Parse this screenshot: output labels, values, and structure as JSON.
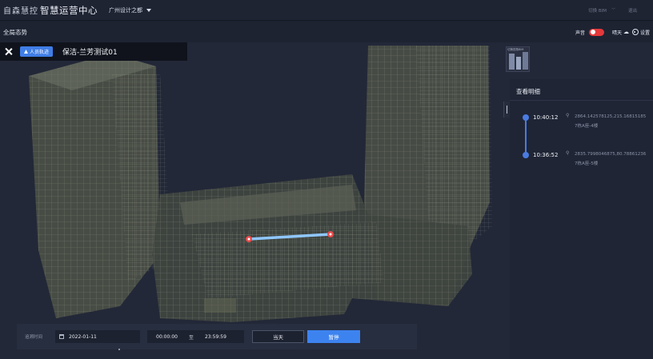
{
  "header": {
    "brand_logo": "自森慧控",
    "brand_title": "智慧运营中心",
    "project": "广州设计之都",
    "user": "切换 BIM",
    "logout": "退出"
  },
  "subheader": {
    "title": "全局态势",
    "sound_label": "声音",
    "weather_label": "晴天",
    "settings_label": "设置"
  },
  "track": {
    "tag": "人员轨迹",
    "name": "保洁-兰芳测试01"
  },
  "thumbnail": {
    "label": "切换视角BIM"
  },
  "panel": {
    "title": "查看明细",
    "records": [
      {
        "time": "10:40:12",
        "coord": "2864.142578125,215.16815185",
        "floor": "7栋A座-4楼"
      },
      {
        "time": "10:36:52",
        "coord": "2835.7998046875,80.78861236",
        "floor": "7栋A座-5楼"
      }
    ]
  },
  "query": {
    "label": "追溯时间",
    "date": "2022-01-11",
    "start_time": "00:00:00",
    "separator": "至",
    "end_time": "23:59:59",
    "today_btn": "当天",
    "pause_btn": "暂停"
  },
  "colors": {
    "accent": "#3d83ef",
    "toggle": "#e5383b",
    "track_line": "#8fc7ff",
    "marker": "#e84b4b"
  }
}
